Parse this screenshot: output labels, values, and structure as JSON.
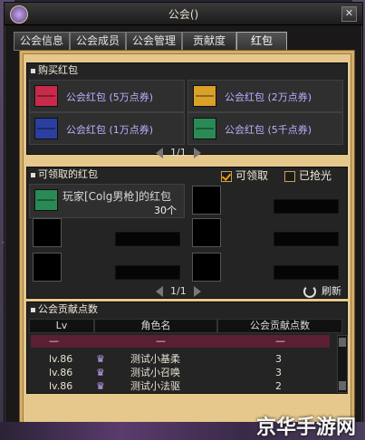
{
  "window": {
    "title": "公会()",
    "close_symbol": "✕"
  },
  "tabs": [
    {
      "label": "公会信息",
      "active": false
    },
    {
      "label": "公会成员",
      "active": false
    },
    {
      "label": "公会管理",
      "active": false
    },
    {
      "label": "贡献度",
      "active": false
    },
    {
      "label": "红包",
      "active": true
    }
  ],
  "side": {
    "left_text": "ㄟ",
    "right_text": "ㄟ"
  },
  "buy": {
    "header": "购买红包",
    "items": [
      {
        "label": "公会红包 (5万点券)",
        "color": "#c82a4a"
      },
      {
        "label": "公会红包 (2万点券)",
        "color": "#d9a12a"
      },
      {
        "label": "公会红包 (1万点券)",
        "color": "#2a3fa0"
      },
      {
        "label": "公会红包 (5千点券)",
        "color": "#2a8a55"
      }
    ],
    "page": "1/1"
  },
  "receive": {
    "header": "可领取的红包",
    "filter_receivable": "可领取",
    "filter_taken": "已抢光",
    "item": {
      "label": "玩家[Colg男枪]的红包",
      "count": "30个",
      "color": "#2a8a55"
    },
    "page": "1/1",
    "refresh": "刷新"
  },
  "contrib": {
    "header": "公会贡献点数",
    "columns": [
      "Lv",
      "角色名",
      "公会贡献点数"
    ],
    "rows": [
      {
        "lv": "—",
        "name": "—",
        "points": "—"
      },
      {
        "lv": "lv.86",
        "name": "测试小基柔",
        "points": "3"
      },
      {
        "lv": "lv.86",
        "name": "测试小召唤",
        "points": "3"
      },
      {
        "lv": "lv.86",
        "name": "测试小法驱",
        "points": "2"
      }
    ]
  },
  "watermark": "京华手游网"
}
